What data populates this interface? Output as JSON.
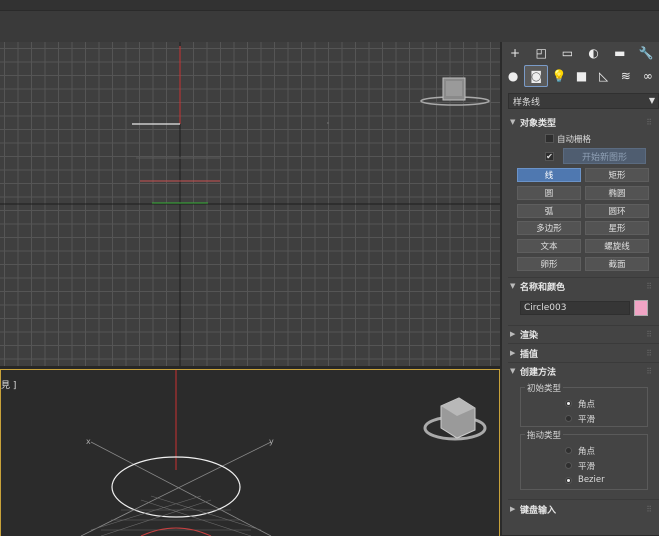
{
  "viewport_bottom": {
    "label": "見 ]"
  },
  "viewport_top": {},
  "panel": {
    "tabs_row1": [
      "+",
      "◰",
      "▭",
      "◐",
      "▬",
      "🔧"
    ],
    "tabs_row2": [
      "●",
      "◙",
      "💡",
      "■",
      "◺",
      "≋",
      "∞"
    ],
    "category": "样条线",
    "rollout_object_type": {
      "title": "对象类型",
      "autogrid": "自动栅格",
      "start_new_shape": "开始新图形",
      "start_new_checked": "✔",
      "buttons": [
        [
          "线",
          "矩形"
        ],
        [
          "圆",
          "椭圆"
        ],
        [
          "弧",
          "圆环"
        ],
        [
          "多边形",
          "星形"
        ],
        [
          "文本",
          "螺旋线"
        ],
        [
          "卵形",
          "截面"
        ]
      ]
    },
    "rollout_name_color": {
      "title": "名称和颜色",
      "name": "Circle003",
      "color": "#f0a4c4"
    },
    "rollout_render": {
      "title": "渲染"
    },
    "rollout_interp": {
      "title": "插值"
    },
    "rollout_creation": {
      "title": "创建方法",
      "initial_type": {
        "label": "初始类型",
        "options": [
          "角点",
          "平滑"
        ],
        "selected": "角点"
      },
      "drag_type": {
        "label": "拖动类型",
        "options": [
          "角点",
          "平滑",
          "Bezier"
        ],
        "selected": "Bezier"
      }
    },
    "rollout_keyboard": {
      "title": "键盘输入"
    },
    "rollout_dots": "⠿"
  }
}
